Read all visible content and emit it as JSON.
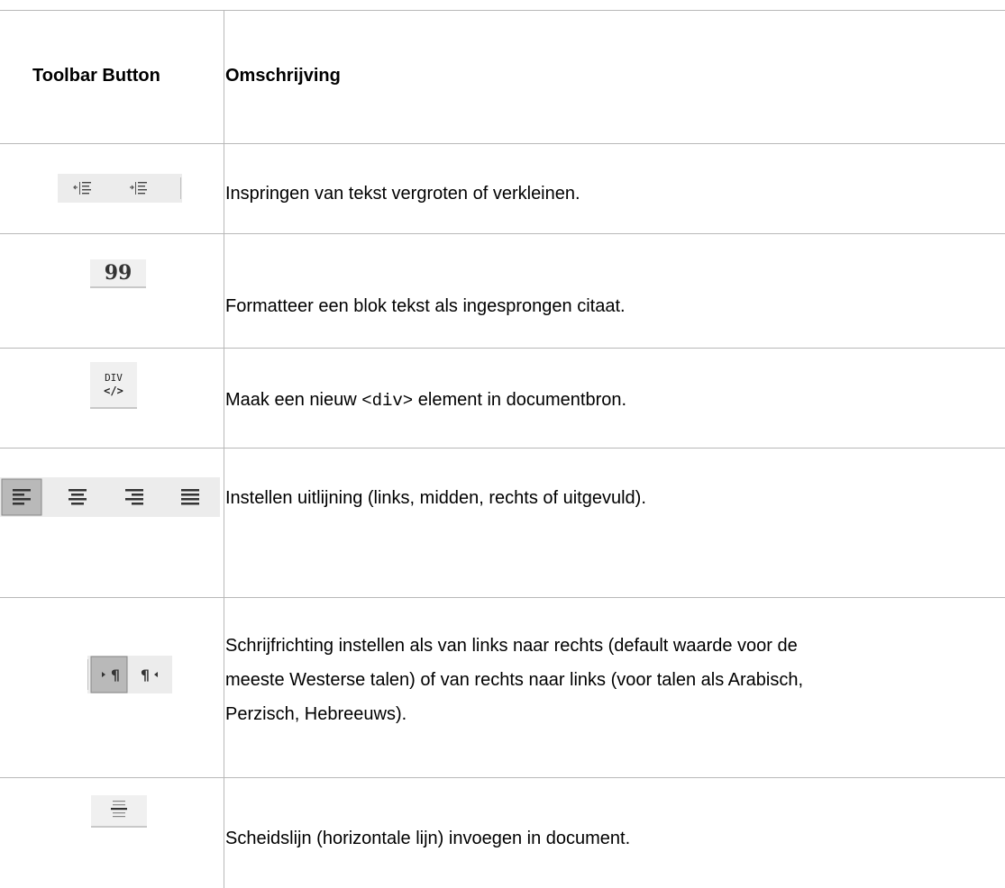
{
  "table": {
    "header": {
      "col1": "Toolbar Button",
      "col2": "Omschrijving"
    },
    "rows": [
      {
        "icons": [
          "indent-increase-icon",
          "indent-decrease-icon"
        ],
        "description": "Inspringen van tekst vergroten of verkleinen."
      },
      {
        "icons": [
          "blockquote-icon"
        ],
        "description": "Formatteer een blok tekst als ingesprongen citaat."
      },
      {
        "icons": [
          "create-div-icon"
        ],
        "description_before": "Maak een nieuw ",
        "description_code": "<div>",
        "description_after": " element in documentbron.",
        "icon_label": "DIV"
      },
      {
        "icons": [
          "align-left-icon",
          "align-center-icon",
          "align-right-icon",
          "align-justify-icon"
        ],
        "description": "Instellen uitlijning (links, midden, rechts of uitgevuld)."
      },
      {
        "icons": [
          "text-direction-ltr-icon",
          "text-direction-rtl-icon"
        ],
        "description_lines": [
          "Schrijfrichting instellen als van links naar rechts (default waarde voor de",
          "meeste Westerse talen) of van rechts naar links (voor talen als Arabisch,",
          "Perzisch, Hebreeuws)."
        ]
      },
      {
        "icons": [
          "horizontal-rule-icon"
        ],
        "description": "Scheidslijn (horizontale lijn) invoegen in document."
      }
    ]
  }
}
